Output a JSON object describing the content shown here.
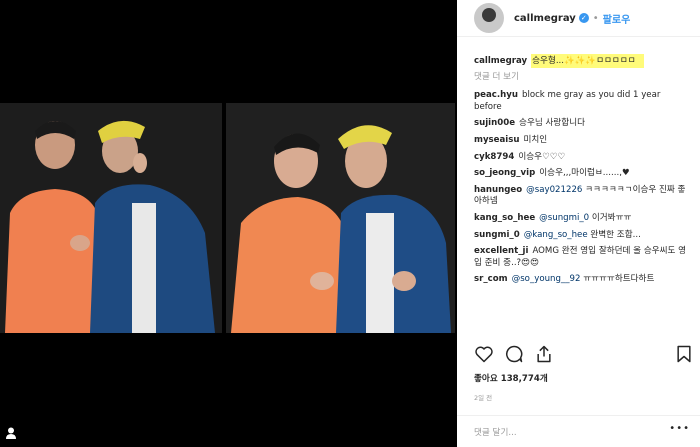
{
  "header": {
    "username": "callmegray",
    "follow_label": "팔로우",
    "dot": "•"
  },
  "caption": {
    "user": "callmegray",
    "text": "승우형...✨✨✨ㅁㅁㅁㅁㅁ"
  },
  "more_comments_label": "댓글 더 보기",
  "comments": [
    {
      "user": "peac.hyu",
      "text": "block me gray as you did 1 year before"
    },
    {
      "user": "sujin00e",
      "text": "승우님 사랑합니다"
    },
    {
      "user": "myseaisu",
      "text": "미치인"
    },
    {
      "user": "cyk8794",
      "text": "이승우♡♡♡"
    },
    {
      "user": "so_jeong_vip",
      "text": "이승우,,,마이럽ㅂ......,♥"
    },
    {
      "user": "hanungeo",
      "mention": "@say021226",
      "text": "ㅋㅋㅋㅋㅋㄱ이승우 진짜 좋아하넴"
    },
    {
      "user": "kang_so_hee",
      "mention": "@sungmi_0",
      "text": "이거봐ㅠㅠ"
    },
    {
      "user": "sungmi_0",
      "mention": "@kang_so_hee",
      "text": "완벽한 조합..."
    },
    {
      "user": "excellent_ji",
      "text": "AOMG 완전 영입 잘하던데 올 승우씨도 영입 준비 중..?😍😍"
    },
    {
      "user": "sr_com",
      "mention": "@so_young__92",
      "text": "ㅠㅠㅠㅠ하트다하트"
    }
  ],
  "likes_text": "좋아요 138,774개",
  "time_text": "2일 전",
  "add_comment_placeholder": "댓글 달기...",
  "more_options": "•••",
  "icons": [
    "heart-icon",
    "comment-icon",
    "share-icon",
    "bookmark-icon",
    "user-tag-icon",
    "verified-icon"
  ],
  "colors": {
    "accent": "#3897f0",
    "highlight": "#fffb7a",
    "shirt_orange": "#f08050",
    "jacket_blue": "#1e4a80"
  }
}
